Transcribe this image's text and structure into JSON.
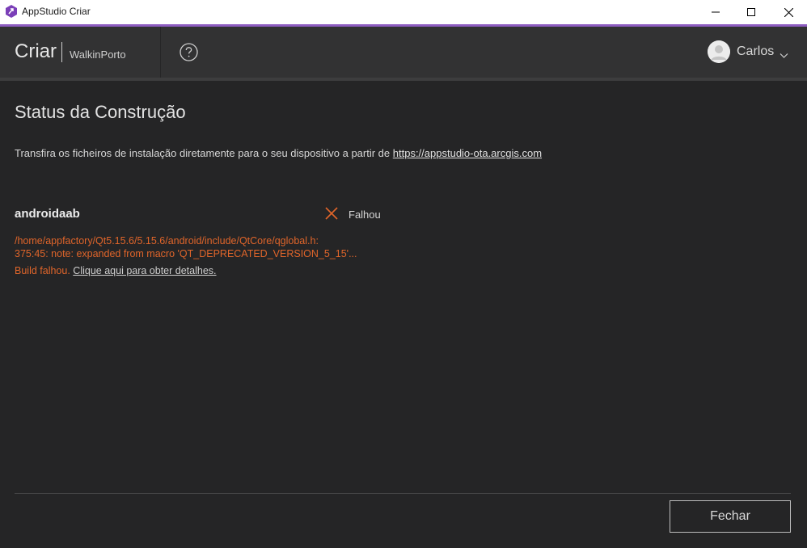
{
  "window": {
    "title": "AppStudio Criar",
    "accent_color": "#8e5dc1"
  },
  "header": {
    "brand": "Criar",
    "project": "WalkinPorto",
    "help_icon": "question-circle-icon",
    "user_name": "Carlos"
  },
  "main": {
    "title": "Status da Construção",
    "description": "Transfira os ficheiros de instalação diretamente para o seu dispositivo a partir de ",
    "description_link": "https://appstudio-ota.arcgis.com",
    "builds": [
      {
        "platform": "androidaab",
        "status": "Falhou",
        "status_icon": "x-icon",
        "error_line_1": "/home/appfactory/Qt5.15.6/5.15.6/android/include/QtCore/qglobal.h:",
        "error_line_2": "375:45: note: expanded from macro 'QT_DEPRECATED_VERSION_5_15'...",
        "build_failed": "Build falhou.",
        "details_link": "Clique aqui para obter detalhes."
      }
    ],
    "error_color": "#e0652a"
  },
  "footer": {
    "close_label": "Fechar"
  }
}
